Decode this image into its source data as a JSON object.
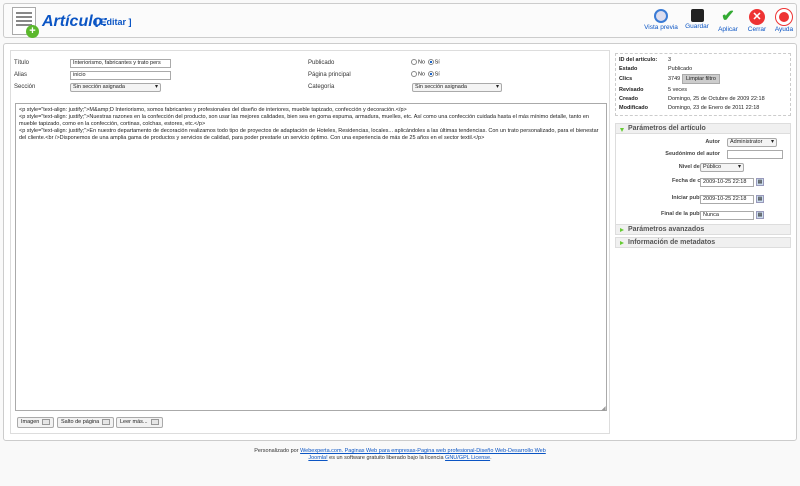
{
  "toolbar": {
    "title": "Artículo:",
    "subtitle": "[ Editar ]",
    "buttons": {
      "preview": "Vista previa",
      "save": "Guardar",
      "apply": "Aplicar",
      "close": "Cerrar",
      "help": "Ayuda"
    }
  },
  "form": {
    "title_label": "Título",
    "title_value": "Interiorismo, fabricantes y trato pers",
    "alias_label": "Alias",
    "alias_value": "inicio",
    "section_label": "Sección",
    "section_value": "Sin sección asignada",
    "published_label": "Publicado",
    "frontpage_label": "Página principal",
    "category_label": "Categoría",
    "category_value": "Sin sección asignada",
    "no": "No",
    "yes": "Sí"
  },
  "editor": {
    "lines": [
      "<p style=\"text-align: justify;\">M&amp;D Interiorismo, somos fabricantes y profesionales del diseño de interiores, mueble tapizado, confección y decoración.</p>",
      "<p style=\"text-align: justify;\">Nuestras razones en la confección del producto, son usar las mejores calidades, bien sea en goma espuma, armadura, muelles, etc. Así como una confección cuidada hasta el más mínimo detalle, tanto en mueble tapizado, como en la confección, cortinas, colchas, estores, etc.</p>",
      "<p style=\"text-align: justify;\">En nuestro departamento de decoración realizamos todo tipo de proyectos de adaptación de Hoteles, Residencias, locales... aplicándoles a las últimas tendencias.  Con un trato personalizado, para el bienestar del cliente.<br />Disponemos de una amplia gama de productos y servicios de calidad, para poder prestarle un servicio óptimo. Con una experiencia de más de 25 años en el sector textil.</p>"
    ],
    "buttons": {
      "image": "Imagen",
      "pagebreak": "Salto de página",
      "readmore": "Leer más..."
    }
  },
  "details": {
    "id_label": "ID del artículo:",
    "id_value": "3",
    "state_label": "Estado",
    "state_value": "Publicado",
    "hits_label": "Clics",
    "hits_value": "3749",
    "reset_button": "Limpiar filtro",
    "revised_label": "Revisado",
    "revised_value": "5 veces",
    "created_label": "Creado",
    "created_value": "Domingo, 25 de Octubre de 2009 22:18",
    "modified_label": "Modificado",
    "modified_value": "Domingo, 23 de Enero de 2011 22:18"
  },
  "params": {
    "header": "Parámetros del artículo",
    "author_label": "Autor",
    "author_value": "Administrator",
    "alias_label": "Seudónimo del autor",
    "alias_value": "",
    "access_label": "Nivel de acceso",
    "access_value": "Público",
    "created_label": "Fecha de creación",
    "created_value": "2009-10-25 22:18",
    "publish_up_label": "Iniciar publicación",
    "publish_up_value": "2009-10-25 22:18",
    "publish_down_label": "Final de la publicación",
    "publish_down_value": "Nunca"
  },
  "panels": {
    "advanced": "Parámetros avanzados",
    "metadata": "Información de metadatos"
  },
  "footer": {
    "prefix": "Personalizado por",
    "link1": "Webexperta.com. Paginas Web para empresas-Pagina web profesional-Diseño Web-Desarrollo Web",
    "joomla": "Joomla!",
    "middle": "es un software gratuito liberado bajo la licencia",
    "license": "GNU/GPL License",
    "end": "."
  },
  "colors": {
    "link": "#0b55c4",
    "accent_green": "#6c3"
  }
}
